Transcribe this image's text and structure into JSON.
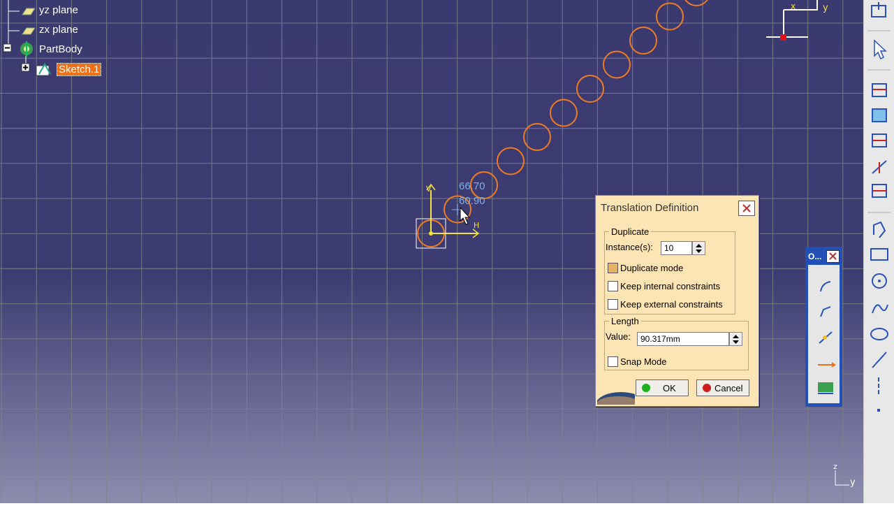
{
  "tree": {
    "items": [
      {
        "label": "yz plane"
      },
      {
        "label": "zx plane"
      },
      {
        "label": "PartBody"
      },
      {
        "label": "Sketch.1"
      }
    ]
  },
  "sketch": {
    "dim_x": "66.70",
    "dim_y": "60.90",
    "axis_h_label": "H",
    "axis_v_label": "V"
  },
  "compass": {
    "x_label": "x",
    "y_label": "y"
  },
  "corner_axes": {
    "z_label": "z",
    "y_label": "y"
  },
  "dialog": {
    "title": "Translation Definition",
    "duplicate_group": "Duplicate",
    "instances_label": "Instance(s):",
    "instances_value": "10",
    "duplicate_mode": {
      "label": "Duplicate mode",
      "checked": true
    },
    "keep_internal": {
      "label": "Keep internal constraints",
      "checked": false
    },
    "keep_external": {
      "label": "Keep external constraints",
      "checked": false
    },
    "length_group": "Length",
    "value_label": "Value:",
    "value": "90.317mm",
    "snap_mode": {
      "label": "Snap Mode",
      "checked": false
    },
    "ok_label": "OK",
    "cancel_label": "Cancel"
  },
  "float_toolbar": {
    "title": "O..."
  },
  "colors": {
    "background": "#3d3c72",
    "grid": "#7f8585",
    "circle": "#f07b20",
    "dimension": "#7fb0e8",
    "axis": "#f4e23a"
  }
}
